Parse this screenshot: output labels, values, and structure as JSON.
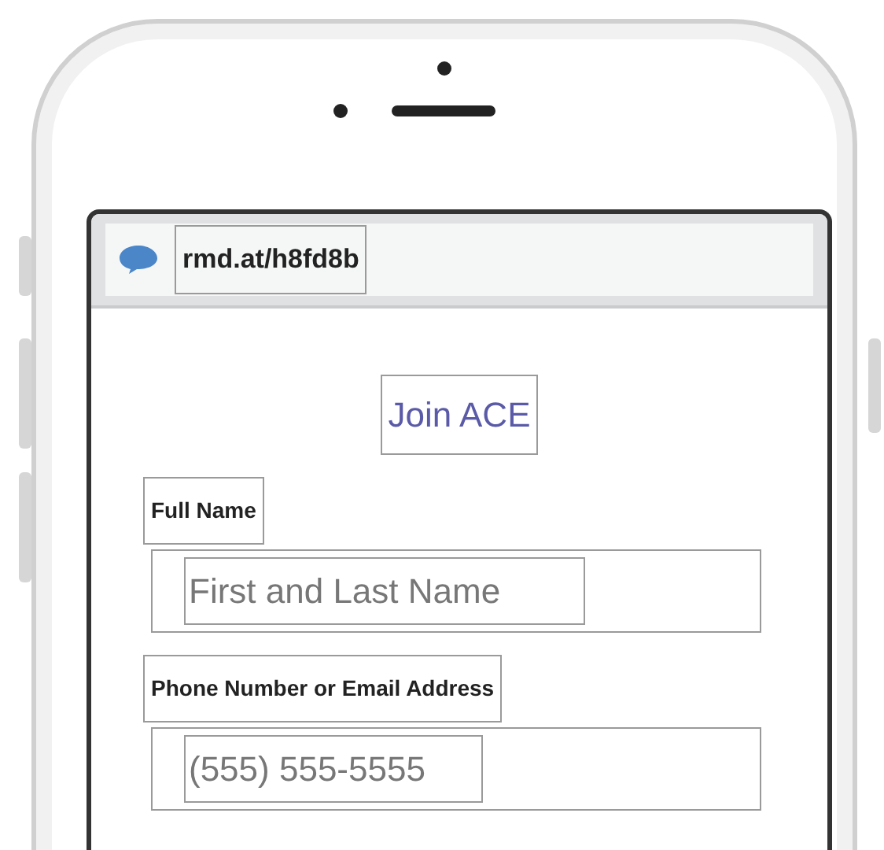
{
  "browser": {
    "url": "rmd.at/h8fd8b"
  },
  "form": {
    "title": "Join ACE",
    "fields": [
      {
        "label": "Full Name",
        "placeholder": "First and Last Name"
      },
      {
        "label": "Phone Number or Email Address",
        "placeholder": "(555) 555-5555"
      }
    ]
  }
}
